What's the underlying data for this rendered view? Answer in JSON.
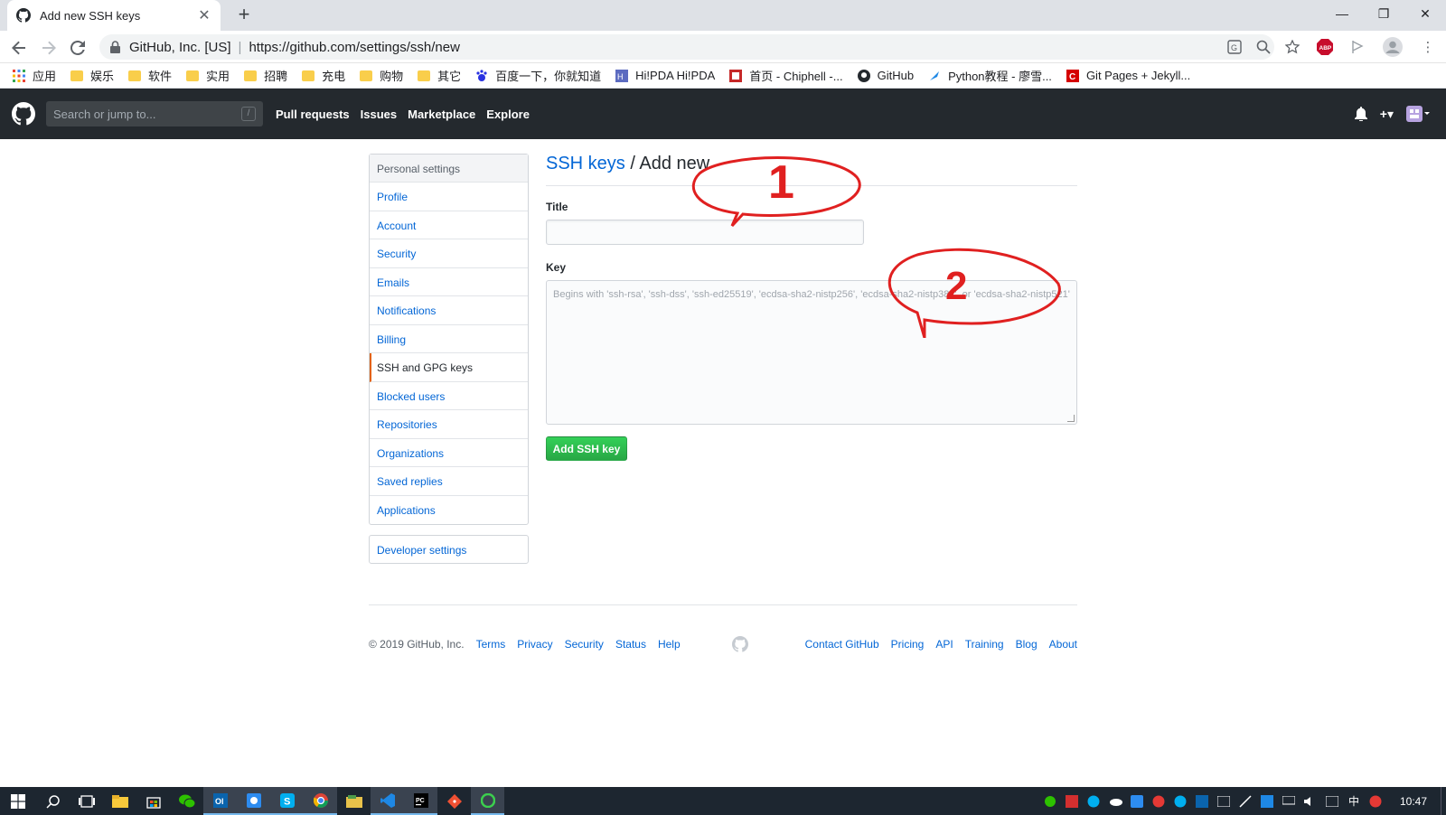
{
  "browser": {
    "tab_title": "Add new SSH keys",
    "new_tab": "+",
    "site_owner": "GitHub, Inc. [US]",
    "separator": "|",
    "url": "https://github.com/settings/ssh/new"
  },
  "bookmarks": [
    {
      "label": "应用",
      "icon": "apps-grid-icon"
    },
    {
      "label": "娱乐",
      "icon": "folder-icon"
    },
    {
      "label": "软件",
      "icon": "folder-icon"
    },
    {
      "label": "实用",
      "icon": "folder-icon"
    },
    {
      "label": "招聘",
      "icon": "folder-icon"
    },
    {
      "label": "充电",
      "icon": "folder-icon"
    },
    {
      "label": "购物",
      "icon": "folder-icon"
    },
    {
      "label": "其它",
      "icon": "folder-icon"
    },
    {
      "label": "百度一下，你就知道",
      "icon": "baidu-icon"
    },
    {
      "label": "Hi!PDA Hi!PDA",
      "icon": "hipda-icon"
    },
    {
      "label": "首页 - Chiphell -...",
      "icon": "chiphell-icon"
    },
    {
      "label": "GitHub",
      "icon": "github-icon"
    },
    {
      "label": "Python教程 - 廖雪...",
      "icon": "rocket-icon"
    },
    {
      "label": "Git Pages + Jekyll...",
      "icon": "c-icon"
    }
  ],
  "header": {
    "search_placeholder": "Search or jump to...",
    "slash": "/",
    "nav": [
      "Pull requests",
      "Issues",
      "Marketplace",
      "Explore"
    ],
    "plus": "+▾"
  },
  "sidebar": {
    "heading": "Personal settings",
    "items": [
      "Profile",
      "Account",
      "Security",
      "Emails",
      "Notifications",
      "Billing",
      "SSH and GPG keys",
      "Blocked users",
      "Repositories",
      "Organizations",
      "Saved replies",
      "Applications"
    ],
    "selected": "SSH and GPG keys",
    "developer": "Developer settings"
  },
  "form": {
    "crumb_link": "SSH keys",
    "crumb_rest": " / Add new",
    "title_label": "Title",
    "title_value": "",
    "key_label": "Key",
    "key_placeholder": "Begins with 'ssh-rsa', 'ssh-dss', 'ssh-ed25519', 'ecdsa-sha2-nistp256', 'ecdsa-sha2-nistp384', or 'ecdsa-sha2-nistp521'",
    "submit": "Add SSH key"
  },
  "annotations": {
    "one": "1",
    "two": "2",
    "color": "#e02020"
  },
  "footer": {
    "copyright": "© 2019 GitHub, Inc.",
    "left_links": [
      "Terms",
      "Privacy",
      "Security",
      "Status",
      "Help"
    ],
    "right_links": [
      "Contact GitHub",
      "Pricing",
      "API",
      "Training",
      "Blog",
      "About"
    ]
  },
  "taskbar": {
    "clock": "10:47",
    "ime": "中"
  },
  "colors": {
    "link": "#0366d6",
    "header_bg": "#24292e",
    "green": "#28a745",
    "selected_border": "#e36209"
  }
}
